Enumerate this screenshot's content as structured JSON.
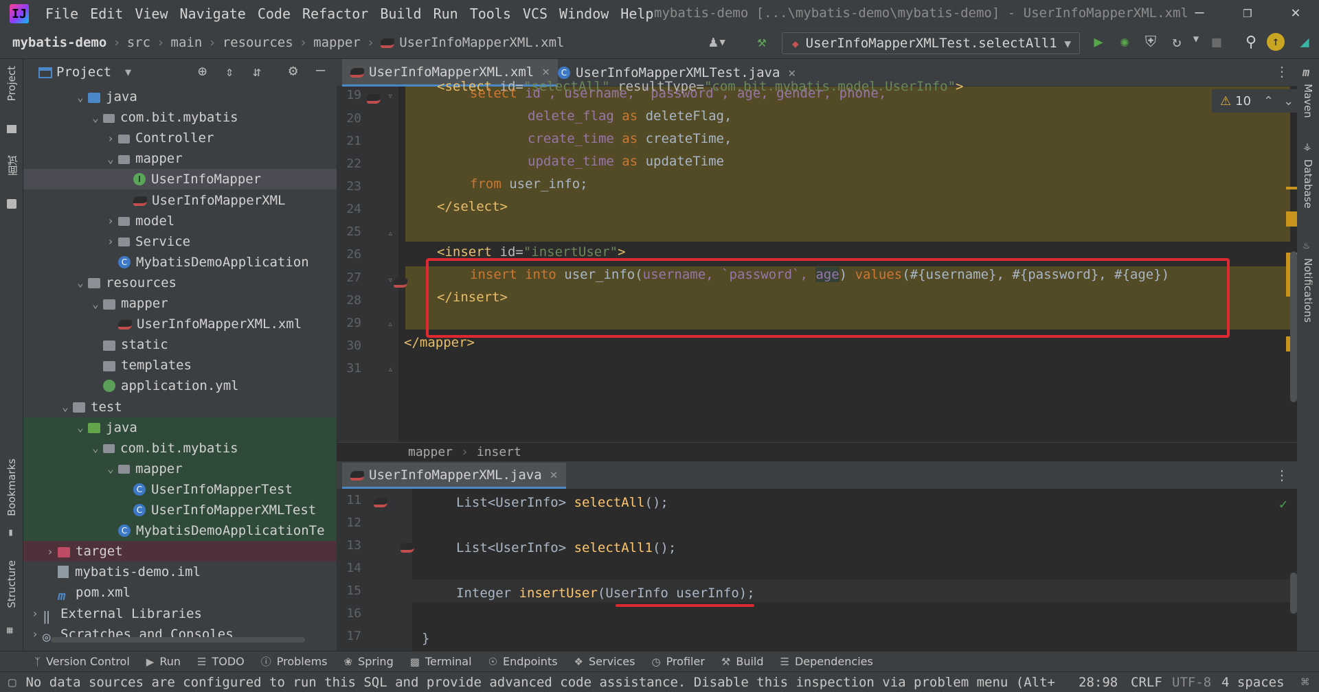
{
  "menu": {
    "items": [
      "File",
      "Edit",
      "View",
      "Navigate",
      "Code",
      "Refactor",
      "Build",
      "Run",
      "Tools",
      "VCS",
      "Window",
      "Help"
    ],
    "window_title": "mybatis-demo [...\\mybatis-demo\\mybatis-demo] - UserInfoMapperXML.xml"
  },
  "nav": {
    "breadcrumb": [
      "mybatis-demo",
      "src",
      "main",
      "resources",
      "mapper",
      "UserInfoMapperXML.xml"
    ],
    "run_config": "UserInfoMapperXMLTest.selectAll1"
  },
  "project_panel": {
    "title": "Project",
    "tree": [
      {
        "label": "java",
        "indent": 3,
        "arrow": "v",
        "icon": "folder-blue"
      },
      {
        "label": "com.bit.mybatis",
        "indent": 4,
        "arrow": "v",
        "icon": "package"
      },
      {
        "label": "Controller",
        "indent": 5,
        "arrow": ">",
        "icon": "package"
      },
      {
        "label": "mapper",
        "indent": 5,
        "arrow": "v",
        "icon": "package"
      },
      {
        "label": "UserInfoMapper",
        "indent": 6,
        "arrow": "",
        "icon": "interface",
        "selected": true
      },
      {
        "label": "UserInfoMapperXML",
        "indent": 6,
        "arrow": "",
        "icon": "mybatis"
      },
      {
        "label": "model",
        "indent": 5,
        "arrow": ">",
        "icon": "package"
      },
      {
        "label": "Service",
        "indent": 5,
        "arrow": ">",
        "icon": "package"
      },
      {
        "label": "MybatisDemoApplication",
        "indent": 5,
        "arrow": "",
        "icon": "class"
      },
      {
        "label": "resources",
        "indent": 3,
        "arrow": "v",
        "icon": "folder"
      },
      {
        "label": "mapper",
        "indent": 4,
        "arrow": "v",
        "icon": "folder"
      },
      {
        "label": "UserInfoMapperXML.xml",
        "indent": 5,
        "arrow": "",
        "icon": "mybatis"
      },
      {
        "label": "static",
        "indent": 4,
        "arrow": "",
        "icon": "folder"
      },
      {
        "label": "templates",
        "indent": 4,
        "arrow": "",
        "icon": "folder"
      },
      {
        "label": "application.yml",
        "indent": 4,
        "arrow": "",
        "icon": "yml"
      },
      {
        "label": "test",
        "indent": 2,
        "arrow": "v",
        "icon": "folder"
      },
      {
        "label": "java",
        "indent": 3,
        "arrow": "v",
        "icon": "folder-green",
        "test": true
      },
      {
        "label": "com.bit.mybatis",
        "indent": 4,
        "arrow": "v",
        "icon": "package",
        "test": true
      },
      {
        "label": "mapper",
        "indent": 5,
        "arrow": "v",
        "icon": "package",
        "test": true
      },
      {
        "label": "UserInfoMapperTest",
        "indent": 6,
        "arrow": "",
        "icon": "class",
        "test": true
      },
      {
        "label": "UserInfoMapperXMLTest",
        "indent": 6,
        "arrow": "",
        "icon": "class",
        "test": true
      },
      {
        "label": "MybatisDemoApplicationTe",
        "indent": 5,
        "arrow": "",
        "icon": "class",
        "test": true
      },
      {
        "label": "target",
        "indent": 1,
        "arrow": ">",
        "icon": "folder-red",
        "excluded": true
      },
      {
        "label": "mybatis-demo.iml",
        "indent": 1,
        "arrow": "",
        "icon": "file"
      },
      {
        "label": "pom.xml",
        "indent": 1,
        "arrow": "",
        "icon": "maven"
      },
      {
        "label": "External Libraries",
        "indent": 0,
        "arrow": ">",
        "icon": "lib"
      },
      {
        "label": "Scratches and Consoles",
        "indent": 0,
        "arrow": ">",
        "icon": "scratch"
      }
    ]
  },
  "editor": {
    "tabs": [
      {
        "label": "UserInfoMapperXML.xml",
        "active": true
      },
      {
        "label": "UserInfoMapperXMLTest.java",
        "active": false
      }
    ],
    "warnings": "10",
    "line_numbers": [
      "19",
      "20",
      "21",
      "22",
      "23",
      "24",
      "25",
      "26",
      "27",
      "28",
      "29",
      "30",
      "31"
    ],
    "lines": {
      "l19": {
        "a": "<select ",
        "b": "id=",
        "c": "\"selectAll\"",
        "d": " resultType=",
        "e": "\"com.bit.mybatis.model.UserInfo\"",
        "f": ">"
      },
      "l20": {
        "a": "select ",
        "b": "id , username, `password`, age, gender, phone,"
      },
      "l21": {
        "a": "delete_flag ",
        "b": "as ",
        "c": "deleteFlag,"
      },
      "l22": {
        "a": "create_time ",
        "b": "as ",
        "c": "createTime,"
      },
      "l23": {
        "a": "update_time ",
        "b": "as ",
        "c": "updateTime"
      },
      "l24": {
        "a": "from ",
        "b": "user_info;"
      },
      "l25": {
        "a": "</select>"
      },
      "l27": {
        "a": "<insert ",
        "b": "id=",
        "c": "\"insertUser\"",
        "d": ">"
      },
      "l28": {
        "a": "insert into ",
        "b": "user_info(",
        "c": "username, `password`, ",
        "d": "age",
        "e": ") ",
        "f": "values",
        "g": "(#{username}, #{password}, #{age})"
      },
      "l29": {
        "a": "</insert>"
      },
      "l31": {
        "a": "</mapper>"
      }
    },
    "breadcrumb": [
      "mapper",
      "insert"
    ]
  },
  "editor2": {
    "tab": "UserInfoMapperXML.java",
    "line_numbers": [
      "11",
      "12",
      "13",
      "14",
      "15",
      "16",
      "17"
    ],
    "l11": {
      "a": "List<UserInfo> ",
      "b": "selectAll",
      "c": "();"
    },
    "l13": {
      "a": "List<UserInfo> ",
      "b": "selectAll1",
      "c": "();"
    },
    "l15": {
      "a": "Integer ",
      "b": "insertUser",
      "c": "(UserInfo userInfo);"
    },
    "l17": "}"
  },
  "left_strip": {
    "project": "Project",
    "cn": "面试",
    "bookmarks": "Bookmarks",
    "structure": "Structure"
  },
  "right_strip": {
    "maven": "Maven",
    "database": "Database",
    "notifications": "Notifications"
  },
  "tool_windows": [
    "Version Control",
    "Run",
    "TODO",
    "Problems",
    "Spring",
    "Terminal",
    "Endpoints",
    "Services",
    "Profiler",
    "Build",
    "Dependencies"
  ],
  "status": {
    "message": "No data sources are configured to run this SQL and provide advanced code assistance. Disable this inspection via problem menu (Alt+Ente",
    "position": "28:98",
    "line_sep": "CRLF",
    "encoding": "UTF-8",
    "indent": "4 spaces"
  },
  "colors": {
    "accent": "#4a88c7",
    "highlight": "#534a26",
    "annotation": "#e02830"
  }
}
